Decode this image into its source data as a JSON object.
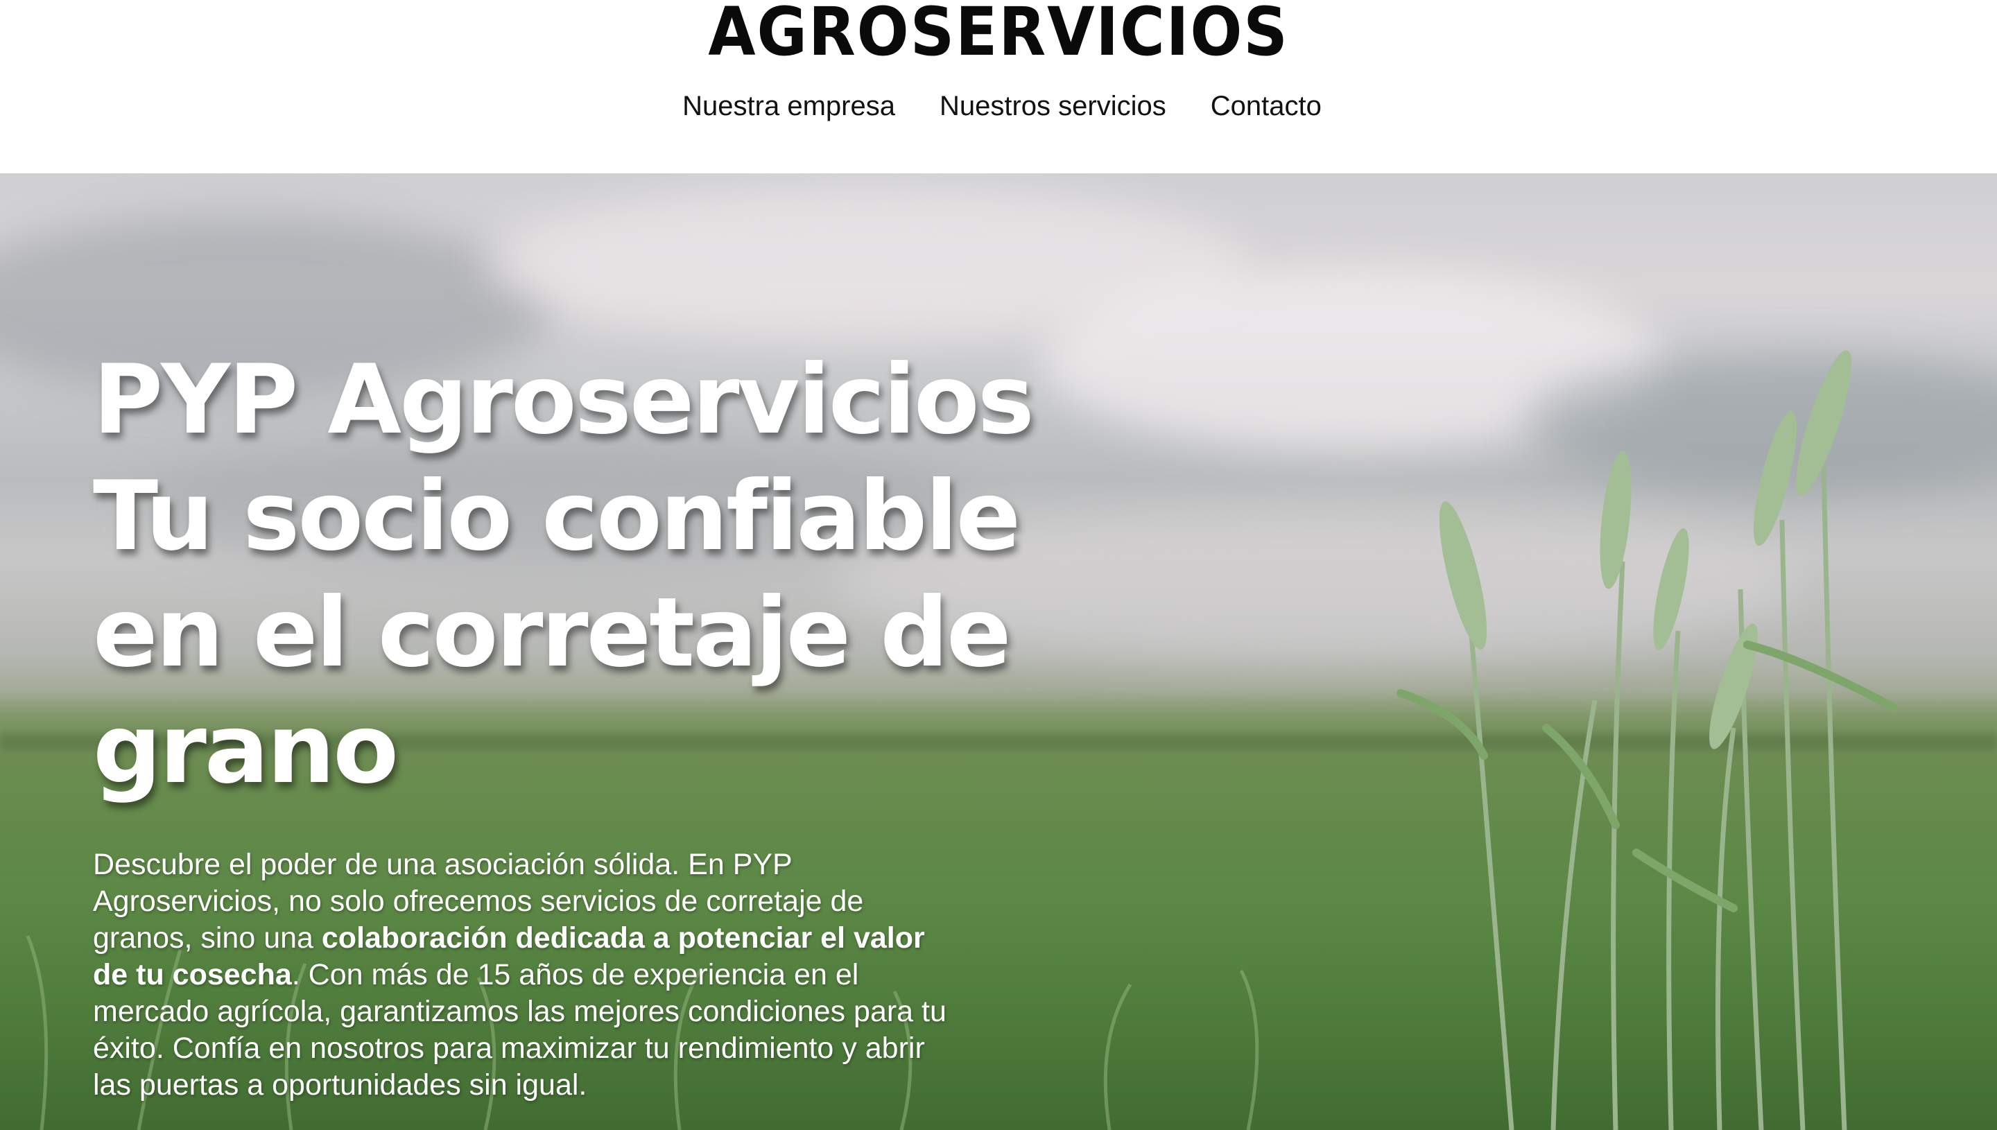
{
  "header": {
    "logo": "AGROSERVICIOS",
    "nav": [
      {
        "label": "Nuestra empresa"
      },
      {
        "label": "Nuestros servicios"
      },
      {
        "label": "Contacto"
      }
    ]
  },
  "hero": {
    "title_lines": [
      "PYP Agroservicios",
      "Tu socio confiable",
      "en el corretaje de",
      "grano"
    ],
    "description": {
      "part1": "Descubre el poder de una asociación sólida. En PYP Agroservicios, no solo ofrecemos servicios de corretaje de granos, sino una ",
      "bold": "colaboración dedicada a potenciar el valor de tu cosecha",
      "part2": ". Con más de 15 años de experiencia en el mercado agrícola, garantizamos las mejores condiciones para tu éxito. Confía en nosotros para maximizar tu rendimiento y abrir las puertas a oportunidades sin igual."
    },
    "background": "wheat-field-photo"
  },
  "colors": {
    "header_bg": "#ffffff",
    "logo_text": "#0a0a0a",
    "hero_text": "#ffffff",
    "field_green": "#5c8246"
  }
}
